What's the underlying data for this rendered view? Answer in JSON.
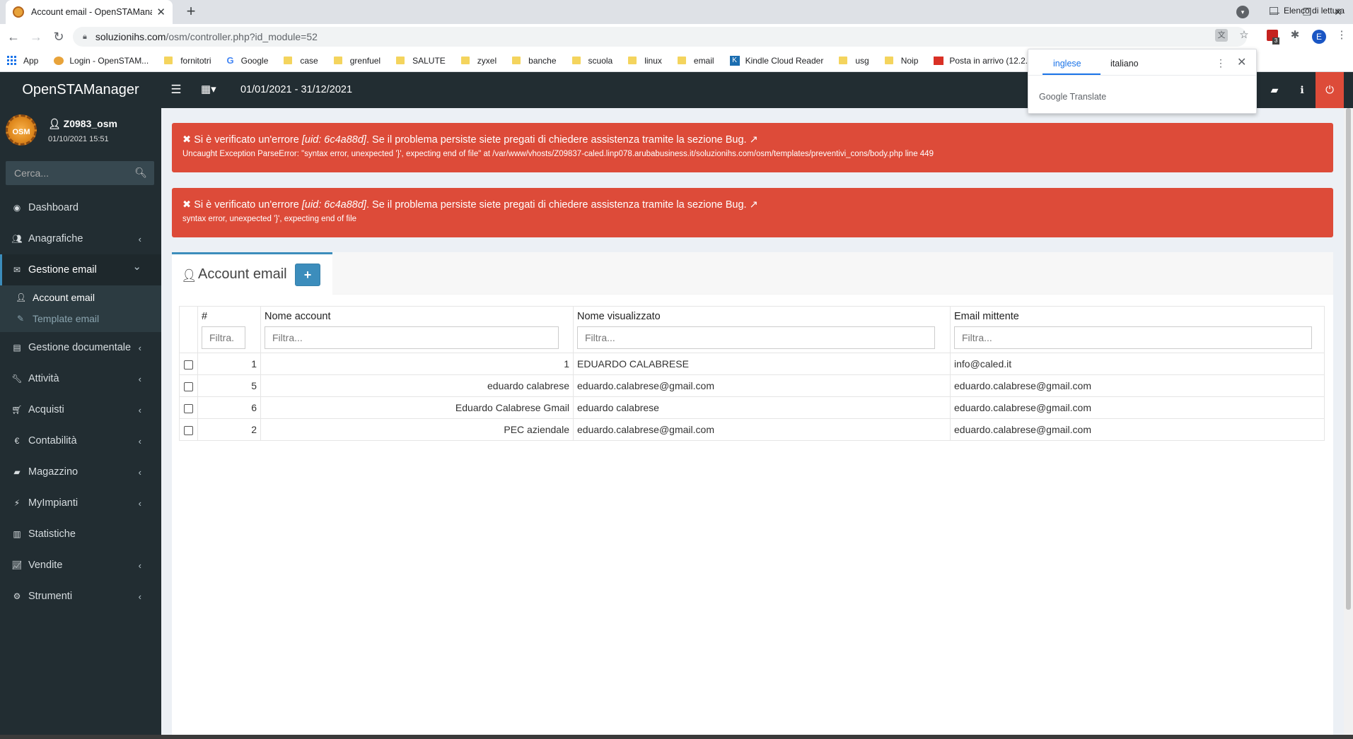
{
  "browser": {
    "tab_title": "Account email - OpenSTAManag",
    "url_host": "soluzionihs.com",
    "url_path": "/osm/controller.php?id_module=52",
    "avatar_letter": "E",
    "ext_badge": "3",
    "bookmarks": [
      {
        "label": "App",
        "icon": "apps-icon"
      },
      {
        "label": "Login - OpenSTAM...",
        "icon": "osm-icon"
      },
      {
        "label": "fornitotri",
        "icon": "folder-icon"
      },
      {
        "label": "Google",
        "icon": "google-icon"
      },
      {
        "label": "case",
        "icon": "folder-icon"
      },
      {
        "label": "grenfuel",
        "icon": "folder-icon"
      },
      {
        "label": "SALUTE",
        "icon": "folder-icon"
      },
      {
        "label": "zyxel",
        "icon": "folder-icon"
      },
      {
        "label": "banche",
        "icon": "folder-icon"
      },
      {
        "label": "scuola",
        "icon": "folder-icon"
      },
      {
        "label": "linux",
        "icon": "folder-icon"
      },
      {
        "label": "email",
        "icon": "folder-icon"
      },
      {
        "label": "Kindle Cloud Reader",
        "icon": "kindle-icon"
      },
      {
        "label": "usg",
        "icon": "folder-icon"
      },
      {
        "label": "Noip",
        "icon": "folder-icon"
      },
      {
        "label": "Posta in arrivo (12.2...",
        "icon": "gmail-icon"
      }
    ],
    "reading_list": "Elenco di lettura"
  },
  "translate_popup": {
    "lang_source": "inglese",
    "lang_target": "italiano",
    "brand": "Google Translate"
  },
  "header": {
    "logo": "OpenSTAManager",
    "period": "01/01/2021 - 31/12/2021",
    "accent_color": "#3c8dbc",
    "danger_color": "#dd4b39"
  },
  "user": {
    "logo_text": "OSM",
    "name": "Z0983_osm",
    "datetime": "01/10/2021 15:51"
  },
  "sidebar": {
    "search_placeholder": "Cerca...",
    "items": [
      {
        "label": "Dashboard",
        "icon": "dashboard-icon",
        "chevron": false
      },
      {
        "label": "Anagrafiche",
        "icon": "users-icon",
        "chevron": true
      },
      {
        "label": "Gestione email",
        "icon": "envelope-icon",
        "chevron": true,
        "expanded": true
      },
      {
        "label": "Gestione documentale",
        "icon": "document-icon",
        "chevron": true
      },
      {
        "label": "Attività",
        "icon": "wrench-icon",
        "chevron": true
      },
      {
        "label": "Acquisti",
        "icon": "cart-icon",
        "chevron": true
      },
      {
        "label": "Contabilità",
        "icon": "euro-icon",
        "chevron": true
      },
      {
        "label": "Magazzino",
        "icon": "truck-icon",
        "chevron": true
      },
      {
        "label": "MyImpianti",
        "icon": "plug-icon",
        "chevron": true
      },
      {
        "label": "Statistiche",
        "icon": "bar-chart-icon",
        "chevron": false
      },
      {
        "label": "Vendite",
        "icon": "line-chart-icon",
        "chevron": true
      },
      {
        "label": "Strumenti",
        "icon": "cog-icon",
        "chevron": true
      }
    ],
    "submenu": [
      {
        "label": "Account email",
        "icon": "user-icon",
        "active": true
      },
      {
        "label": "Template email",
        "icon": "edit-icon",
        "active": false
      }
    ]
  },
  "alerts": [
    {
      "prefix": "Si è verificato un'errore ",
      "uid": "[uid: 6c4a88d]",
      "suffix": ". Se il problema persiste siete pregati di chiedere assistenza tramite la sezione Bug.",
      "detail": "Uncaught Exception ParseError: \"syntax error, unexpected '}', expecting end of file\" at /var/www/vhosts/Z09837-caled.linp078.arubabusiness.it/soluzionihs.com/osm/templates/preventivi_cons/body.php line 449"
    },
    {
      "prefix": "Si è verificato un'errore ",
      "uid": "[uid: 6c4a88d]",
      "suffix": ". Se il problema persiste siete pregati di chiedere assistenza tramite la sezione Bug.",
      "detail": "syntax error, unexpected '}', expecting end of file"
    }
  ],
  "module": {
    "title": "Account email",
    "add_label": "+"
  },
  "table": {
    "columns": [
      {
        "label": "#",
        "placeholder": "Filtra."
      },
      {
        "label": "Nome account",
        "placeholder": "Filtra..."
      },
      {
        "label": "Nome visualizzato",
        "placeholder": "Filtra..."
      },
      {
        "label": "Email mittente",
        "placeholder": "Filtra..."
      }
    ],
    "rows": [
      {
        "id": "1",
        "account": "1",
        "display": "EDUARDO CALABRESE",
        "sender": "info@caled.it"
      },
      {
        "id": "5",
        "account": "eduardo calabrese",
        "display": "eduardo.calabrese@gmail.com",
        "sender": "eduardo.calabrese@gmail.com"
      },
      {
        "id": "6",
        "account": "Eduardo Calabrese Gmail",
        "display": "eduardo calabrese",
        "sender": "eduardo.calabrese@gmail.com"
      },
      {
        "id": "2",
        "account": "PEC aziendale",
        "display": "eduardo.calabrese@gmail.com",
        "sender": "eduardo.calabrese@gmail.com"
      }
    ]
  }
}
